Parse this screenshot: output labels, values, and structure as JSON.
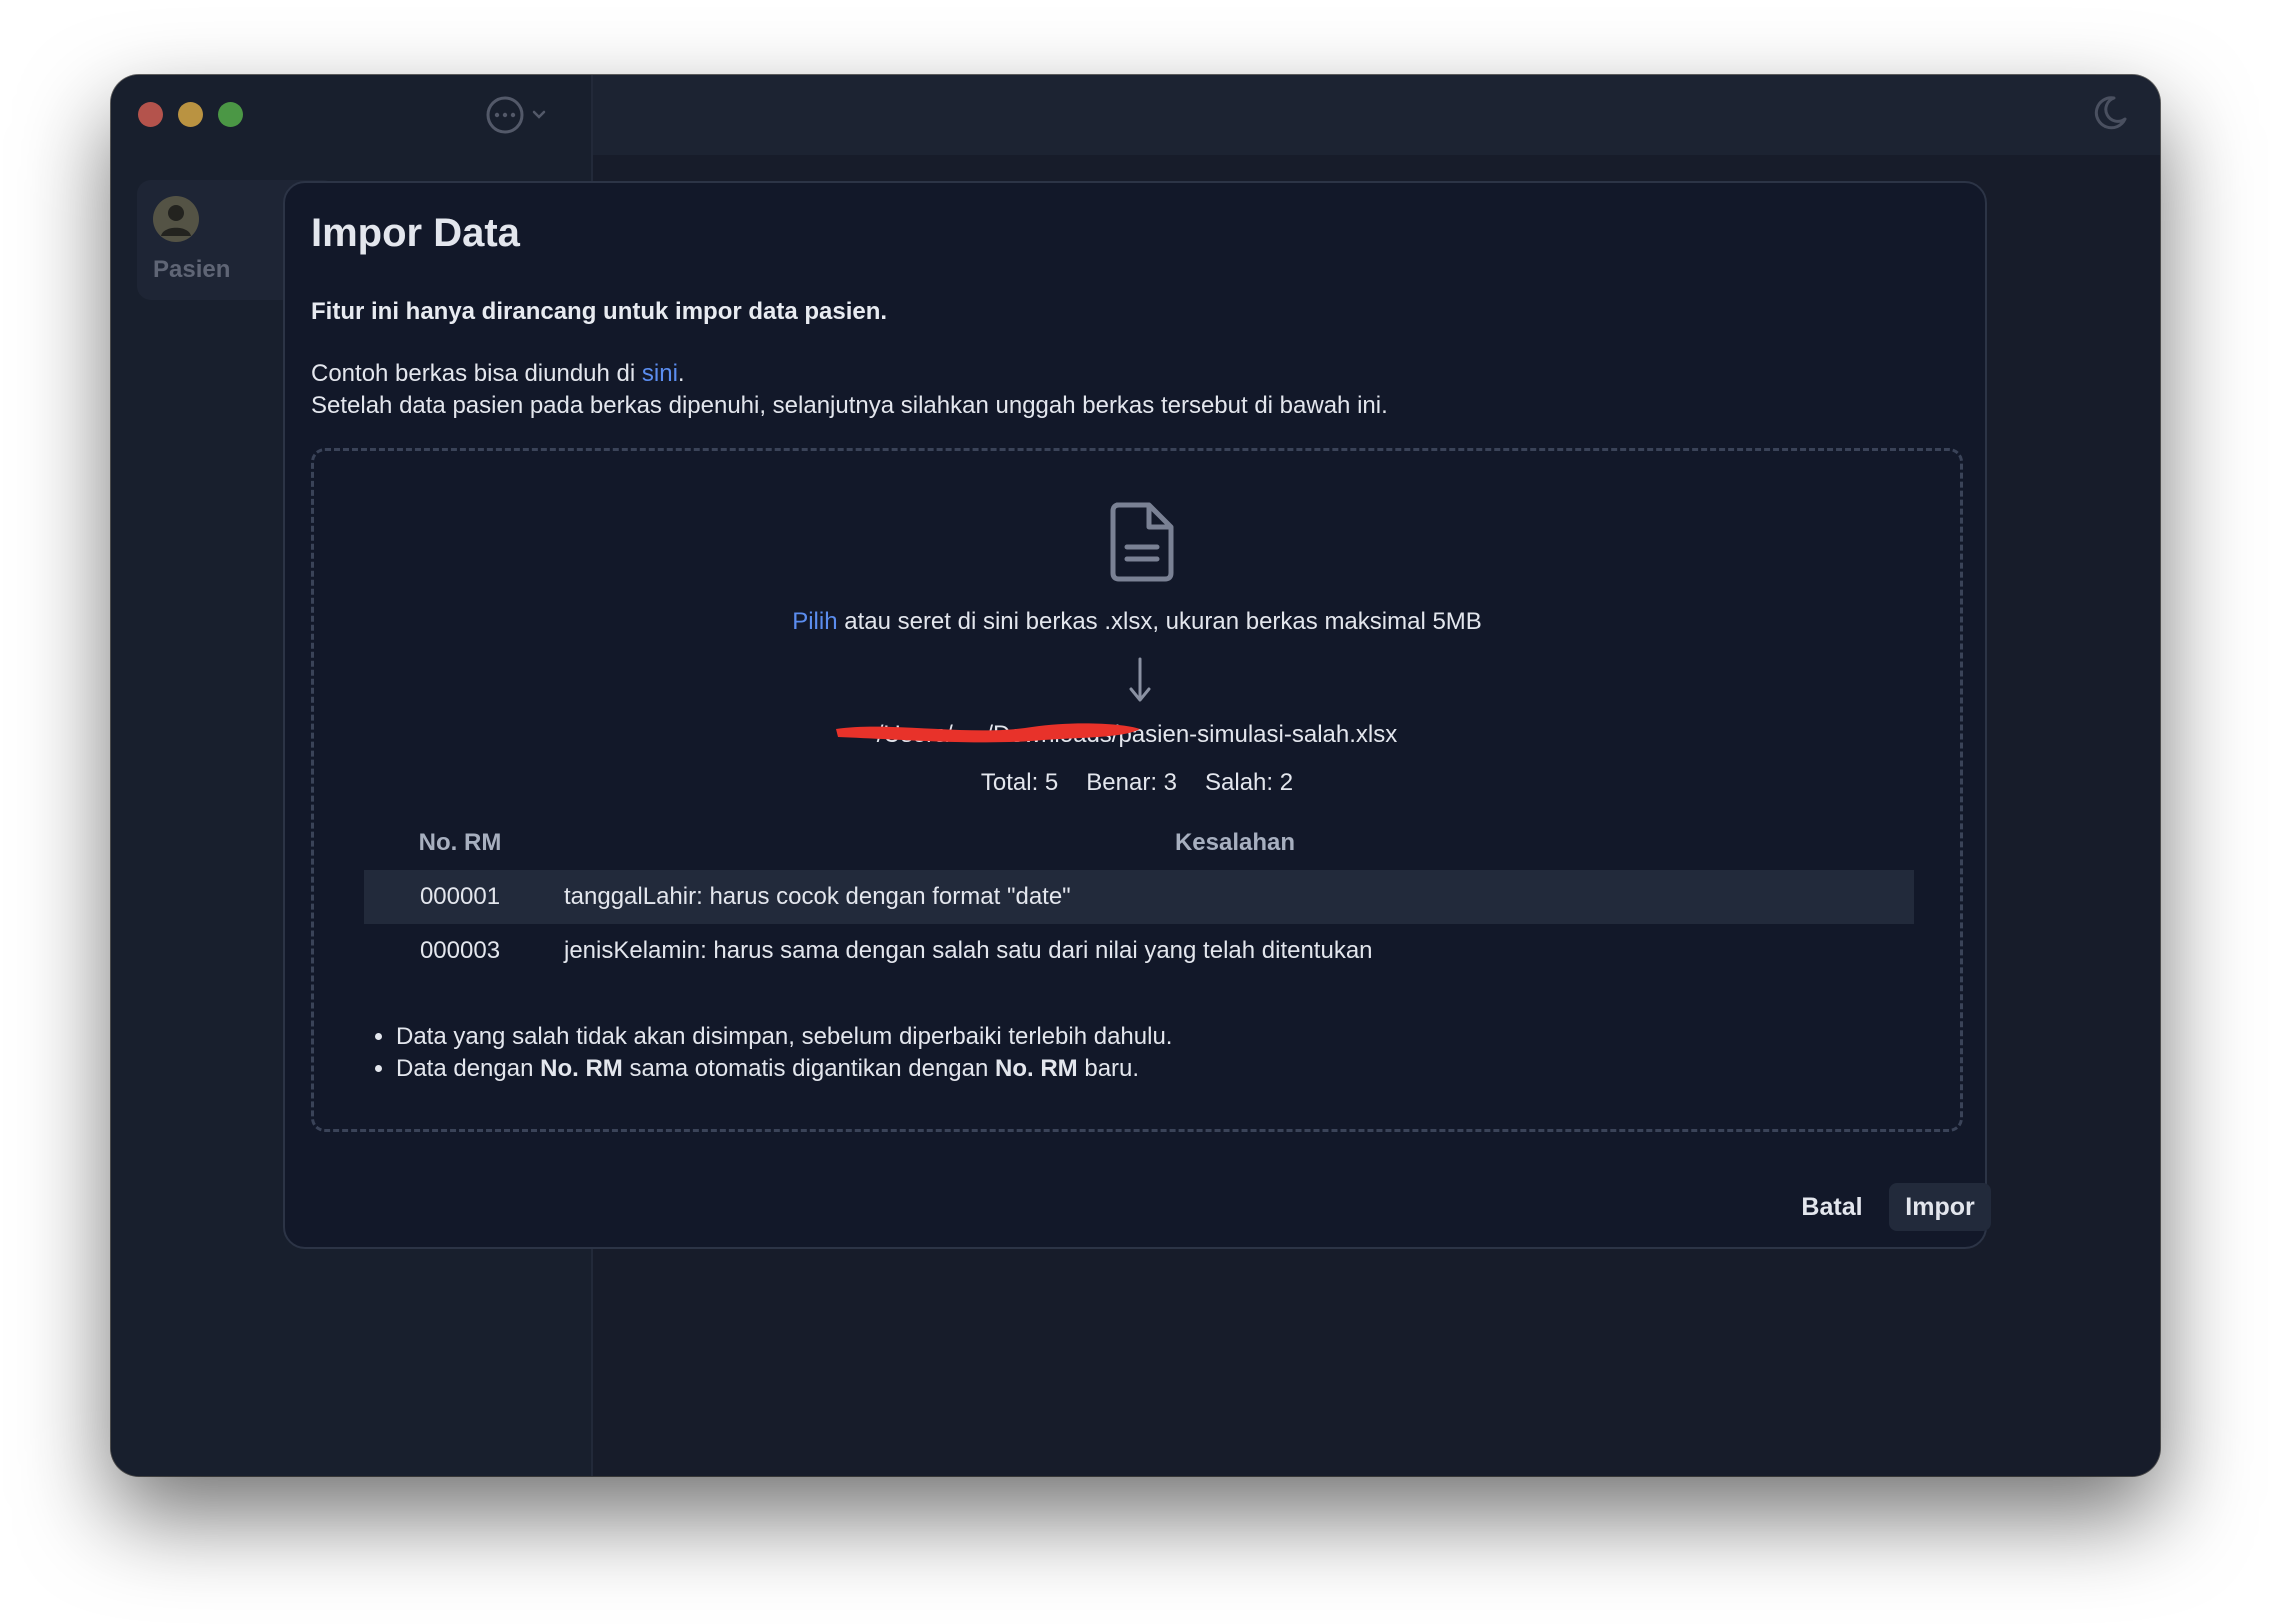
{
  "sidebar": {
    "items": [
      {
        "label": "Pasien",
        "icon": "user-avatar-icon"
      }
    ]
  },
  "titlebar": {
    "menu_icon": "more-circle-icon",
    "theme_icon": "moon-icon"
  },
  "dialog": {
    "title": "Impor Data",
    "notice": "Fitur ini hanya dirancang untuk impor data pasien.",
    "sample_prefix": "Contoh berkas bisa diunduh di ",
    "sample_link": "sini",
    "sample_suffix": ".",
    "instruction": "Setelah data pasien pada berkas dipenuhi, selanjutnya silahkan unggah berkas tersebut di bawah ini.",
    "dropzone": {
      "icon": "document-icon",
      "choose_link": "Pilih",
      "drop_text": " atau seret di sini berkas .xlsx, ukuran berkas maksimal 5MB",
      "arrow_icon": "arrow-down-icon",
      "file_path": "/Users/••••/Downloads/pasien-simulasi-salah.xlsx",
      "stats": {
        "total": "Total: 5",
        "correct": "Benar: 3",
        "wrong": "Salah: 2"
      },
      "table": {
        "headers": [
          "No. RM",
          "Kesalahan"
        ],
        "rows": [
          {
            "rm": "000001",
            "error": "tanggalLahir: harus cocok dengan format \"date\""
          },
          {
            "rm": "000003",
            "error": "jenisKelamin: harus sama dengan salah satu dari nilai yang telah ditentukan"
          }
        ]
      },
      "notes": {
        "note1": "Data yang salah tidak akan disimpan, sebelum diperbaiki terlebih dahulu.",
        "note2_a": "Data dengan ",
        "note2_b": "No. RM",
        "note2_c": " sama otomatis digantikan dengan ",
        "note2_d": "No. RM",
        "note2_e": " baru."
      }
    },
    "cancel_label": "Batal",
    "import_label": "Impor"
  },
  "colors": {
    "link": "#5b8def",
    "background": "#1b2131",
    "modal": "#121829",
    "redaction": "#e8322a"
  }
}
